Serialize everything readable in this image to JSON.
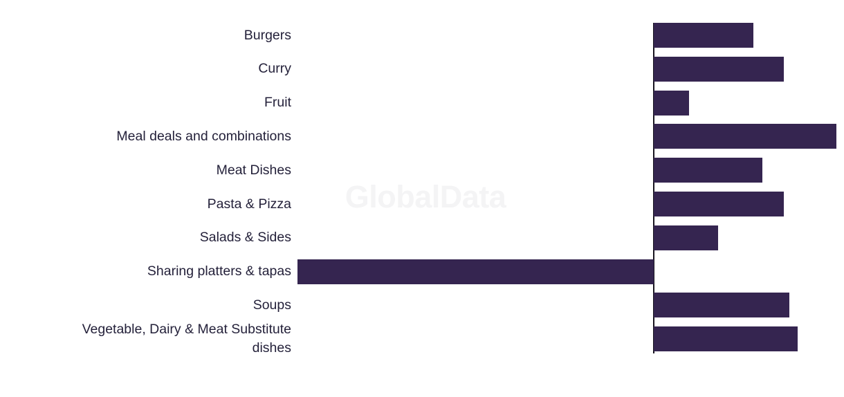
{
  "chart_data": {
    "type": "bar",
    "orientation": "horizontal",
    "title": "",
    "subtitle": "",
    "xlabel": "",
    "ylabel": "",
    "grid": false,
    "legend": null,
    "axis_tick_labels": [],
    "xlim": [
      -56,
      30
    ],
    "zero_line": true,
    "categories": [
      "Burgers",
      "Curry",
      "Fruit",
      "Meal deals and combinations",
      "Meat Dishes",
      "Pasta & Pizza",
      "Salads & Sides",
      "Sharing platters & tapas",
      "Soups",
      "Vegetable, Dairy & Meat Substitute\ndishes"
    ],
    "values": [
      14.7,
      19.2,
      5.3,
      27.0,
      16.1,
      19.2,
      9.5,
      -52.5,
      20.1,
      21.3
    ],
    "bar_color": "#352550",
    "label_color": "#24213a",
    "background_color": "#ffffff"
  },
  "watermark": {
    "text": "GlobalData",
    "color": "#f4f4f5"
  }
}
